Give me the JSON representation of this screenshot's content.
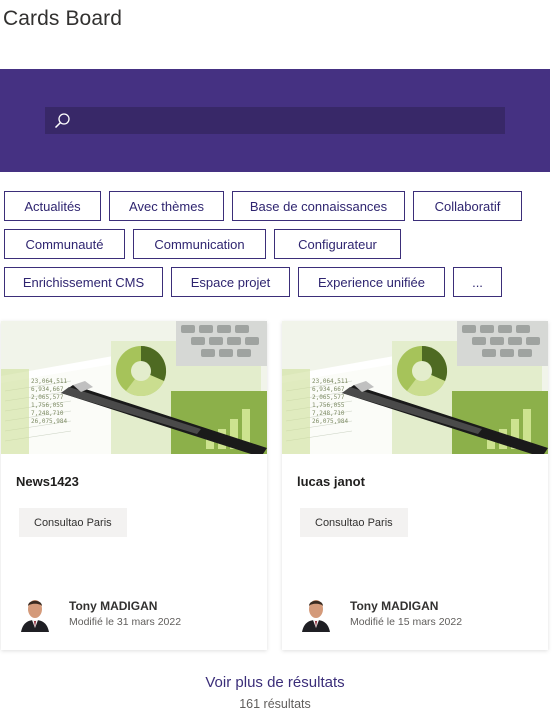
{
  "page": {
    "title": "Cards Board"
  },
  "search": {
    "placeholder": "",
    "value": ""
  },
  "filters": {
    "row1": [
      "Actualités",
      "Avec thèmes",
      "Base de connaissances",
      "Collaboratif"
    ],
    "row2": [
      "Communauté",
      "Communication",
      "Configurateur"
    ],
    "row3": [
      "Enrichissement CMS",
      "Espace projet",
      "Experience unifiée",
      "..."
    ]
  },
  "cards": [
    {
      "title": "News1423",
      "tag": "Consultao Paris",
      "author": "Tony MADIGAN",
      "modified": "Modifié le 31 mars 2022"
    },
    {
      "title": "lucas janot",
      "tag": "Consultao Paris",
      "author": "Tony MADIGAN",
      "modified": "Modifié le 15 mars 2022"
    }
  ],
  "footer": {
    "more_label": "Voir plus de résultats",
    "count_label": "161 résultats"
  },
  "colors": {
    "banner": "#453182",
    "search_box": "#382868",
    "accent": "#3b2e79"
  },
  "icons": {
    "search": "search-icon"
  }
}
